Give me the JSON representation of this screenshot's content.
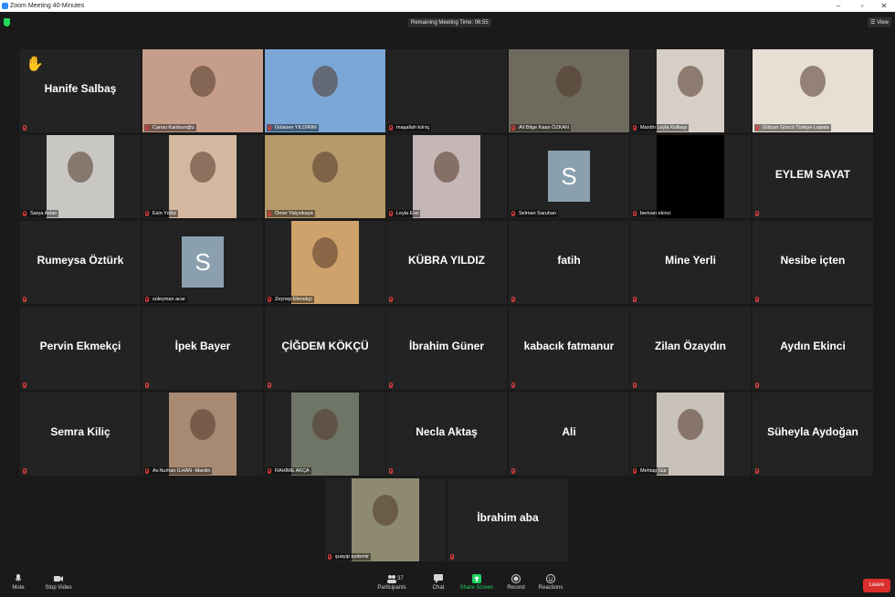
{
  "window": {
    "title": "Zoom Meeting 40-Minutes",
    "minimize": "–",
    "restore": "▫",
    "close": "✕"
  },
  "topbar": {
    "remaining": "Remaining Meeting Time: 06:55",
    "view_label": "View"
  },
  "participants": [
    {
      "id": "p1",
      "display": "Hanife Salbaş",
      "video": false,
      "hand": true
    },
    {
      "id": "p2",
      "display": "Cansu Kanburoğlu",
      "video": true,
      "color": "#c69d8a"
    },
    {
      "id": "p3",
      "display": "Gülsüen YILDIRIM",
      "video": true,
      "active": true,
      "color": "#7aa7d6"
    },
    {
      "id": "p4",
      "display": "maşallah kılınç",
      "video": false,
      "nametext": true
    },
    {
      "id": "p5",
      "display": "AV.Bilge Kaan ÖZKAN",
      "video": true,
      "color": "#6f6a5e"
    },
    {
      "id": "p6",
      "display": "Mardin Leyla Kolbaşı",
      "video": true,
      "color": "#d7cfc7"
    },
    {
      "id": "p7",
      "display": "Gülcan Gözcü Türkiye Lopata",
      "video": true,
      "color": "#e7ded4"
    },
    {
      "id": "p8",
      "display": "Sarya Aslan",
      "video": true,
      "color": "#c9c7c3"
    },
    {
      "id": "p9",
      "display": "Esin Yıldız",
      "video": true,
      "color": "#d3b89f"
    },
    {
      "id": "p10",
      "display": "Ömer Yalçınkaya",
      "video": true,
      "color": "#b79a6b"
    },
    {
      "id": "p11",
      "display": "Leyla Erol",
      "video": true,
      "color": "#c5b7b6"
    },
    {
      "id": "p12",
      "display": "Selman Saruhan",
      "video": false,
      "avatar": "S"
    },
    {
      "id": "p13",
      "display": "berivan ekinci",
      "video": true,
      "color": "#000000"
    },
    {
      "id": "p14",
      "display": "EYLEM SAYAT",
      "video": false
    },
    {
      "id": "p15",
      "display": "Rumeysa Öztürk",
      "video": false
    },
    {
      "id": "p16",
      "display": "süleyman acar",
      "video": false,
      "avatar": "S"
    },
    {
      "id": "p17",
      "display": "Zeynep Ekmekçi",
      "video": true,
      "color": "#d0a26b"
    },
    {
      "id": "p18",
      "display": "KÜBRA YILDIZ",
      "video": false
    },
    {
      "id": "p19",
      "display": "fatih",
      "video": false
    },
    {
      "id": "p20",
      "display": "Mine Yerli",
      "video": false
    },
    {
      "id": "p21",
      "display": "Nesibe içten",
      "video": false
    },
    {
      "id": "p22",
      "display": "Pervin Ekmekçi",
      "video": false
    },
    {
      "id": "p23",
      "display": "İpek Bayer",
      "video": false
    },
    {
      "id": "p24",
      "display": "ÇİĞDEM KÖKÇÜ",
      "video": false
    },
    {
      "id": "p25",
      "display": "İbrahim Güner",
      "video": false
    },
    {
      "id": "p26",
      "display": "kabacık fatmanur",
      "video": false
    },
    {
      "id": "p27",
      "display": "Zilan Özaydın",
      "video": false
    },
    {
      "id": "p28",
      "display": "Aydın Ekinci",
      "video": false
    },
    {
      "id": "p29",
      "display": "Semra Kiliç",
      "video": false
    },
    {
      "id": "p30",
      "display": "Av.Nurhan İLHAN -Mardin",
      "video": true,
      "color": "#a88a73"
    },
    {
      "id": "p31",
      "display": "RAHİME AKÇA",
      "video": true,
      "color": "#6f7566"
    },
    {
      "id": "p32",
      "display": "Necla Aktaş",
      "video": false
    },
    {
      "id": "p33",
      "display": "Ali",
      "video": false
    },
    {
      "id": "p34",
      "display": "Mehtap Gür",
      "video": true,
      "color": "#c9c2ba"
    },
    {
      "id": "p35",
      "display": "Süheyla Aydoğan",
      "video": false
    },
    {
      "id": "p36",
      "display": "şuayip aydemir",
      "video": true,
      "color": "#8d8a6f"
    },
    {
      "id": "p37",
      "display": "İbrahim aba",
      "video": false
    }
  ],
  "toolbar": {
    "mute": "Mute",
    "stop_video": "Stop Video",
    "participants": "Participants",
    "participants_count": "37",
    "chat": "Chat",
    "share": "Share Screen",
    "record": "Record",
    "reactions": "Reactions",
    "leave": "Leave"
  }
}
